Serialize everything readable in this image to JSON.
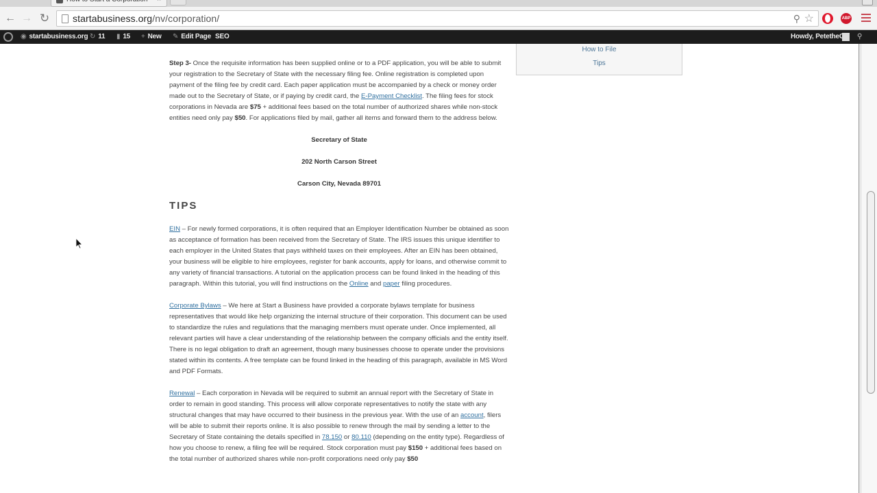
{
  "browser": {
    "tab_title": "How to Start a Corporation",
    "tab_close": "×",
    "url_host": "startabusiness.org",
    "url_path": "/nv/corporation/",
    "abp_label": "ABP"
  },
  "adminbar": {
    "site_name": "startabusiness.org",
    "updates_count": "11",
    "comments_count": "15",
    "new_label": "New",
    "edit_label": "Edit Page",
    "seo_label": "SEO",
    "howdy": "Howdy, PetetheG"
  },
  "sidebar": {
    "links": [
      "How to File",
      "Tips"
    ]
  },
  "content": {
    "step3": {
      "label": "Step 3-",
      "text1": " Once the requisite information has been supplied online or to a PDF application, you will be able to submit your registration to the Secretary of State with the necessary filing fee. Online registration is completed upon payment of the filing fee by credit card. Each paper application must be accompanied by a check or money order made out to the Secretary of State, or if paying by credit card, the ",
      "link": "E-Payment Checklist",
      "text2": ". The filing fees for stock corporations in Nevada are ",
      "fee1": "$75",
      "text3": " + additional fees based on the total number of authorized shares while non-stock entities need only pay ",
      "fee2": "$50",
      "text4": ". For applications filed by mail, gather all items and forward them to the address below."
    },
    "address": [
      "Secretary of State",
      "202 North Carson Street",
      "Carson City, Nevada 89701"
    ],
    "tips_heading": "TIPS",
    "ein": {
      "link": "EIN",
      "text1": " – For newly formed corporations, it is often required that an Employer Identification Number be obtained as soon as acceptance of formation has been received from the Secretary of State. The IRS issues this unique identifier to each employer in the United States that pays withheld taxes on their employees. After an EIN has been obtained, your business will be eligible to hire employees, register for bank accounts, apply for loans, and otherwise commit to any variety of financial transactions. A tutorial on the application process can be found linked in the heading of this paragraph. Within this tutorial, you will find instructions on the ",
      "link_online": "Online",
      "and": " and ",
      "link_paper": "paper",
      "text2": " filing procedures."
    },
    "bylaws": {
      "link": "Corporate Bylaws",
      "text": " – We here at Start a Business have provided a corporate bylaws template for business representatives that would like help organizing the internal structure of their corporation. This document can be used to standardize the rules and regulations that the managing members must operate under. Once implemented, all relevant parties will have a clear understanding of the relationship between the company officials and the entity itself. There is no legal obligation to draft an agreement, though many businesses choose to operate under the provisions stated within its contents. A free template can be found linked in the heading of this paragraph, available in MS Word and PDF Formats."
    },
    "renewal": {
      "link": "Renewal",
      "text1": " – Each corporation in Nevada will be required to submit an annual report with the Secretary of State in order to remain in good standing. This process will allow corporate representatives to notify the state with any structural changes that may have occurred to their business in the previous year. With the use of an ",
      "link_account": "account",
      "text2": ", filers will be able to submit their reports online. It is also possible to renew through the mail by sending a letter to the Secretary of State containing the details specified in ",
      "link_78": "78.150",
      "or": " or  ",
      "link_80": "80.110",
      "text3": " (depending on the entity type). Regardless of how you choose to renew, a filing fee will be required. Stock corporation must pay ",
      "fee1": "$150",
      "text4": " + additional fees based on the total number of authorized shares while non-profit corporations need only pay ",
      "fee2": "$50"
    }
  }
}
